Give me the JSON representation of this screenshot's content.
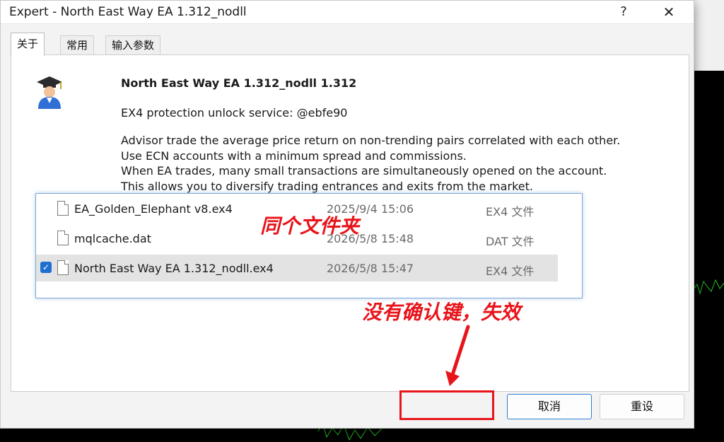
{
  "window": {
    "title": "Expert - North East Way EA 1.312_nodll",
    "help_label": "?",
    "close_label": "✕"
  },
  "tabs": [
    {
      "label": "关于",
      "active": true
    },
    {
      "label": "常用",
      "active": false
    },
    {
      "label": "输入参数",
      "active": false
    }
  ],
  "about": {
    "ea_name": "North East Way EA 1.312_nodll 1.312",
    "unlock_text": "EX4 protection unlock service: @ebfe90",
    "description": [
      "Advisor trade the average price return on non-trending pairs correlated with each other.",
      "Use ECN accounts with a minimum spread and commissions.",
      "When EA trades, many small transactions are simultaneously opened on the account.",
      "This allows you to diversify trading entrances and exits from the market."
    ],
    "icon": "graduate-cap-user-icon"
  },
  "files": [
    {
      "name": "EA_Golden_Elephant v8.ex4",
      "date": "2025/9/4 15:06",
      "type": "EX4 文件",
      "selected": false
    },
    {
      "name": "mqlcache.dat",
      "date": "2026/5/8 15:48",
      "type": "DAT 文件",
      "selected": false
    },
    {
      "name": "North East Way EA 1.312_nodll.ex4",
      "date": "2026/5/8 15:47",
      "type": "EX4 文件",
      "selected": true
    }
  ],
  "buttons": {
    "cancel": "取消",
    "reset": "重设"
  },
  "annotations": {
    "same_folder": "同个文件夹",
    "missing_ok": "没有确认键，失效",
    "color": "#e8141b"
  },
  "colors": {
    "accent": "#1e6fd0",
    "chart_candles": "#22c022",
    "background": "#000000"
  }
}
